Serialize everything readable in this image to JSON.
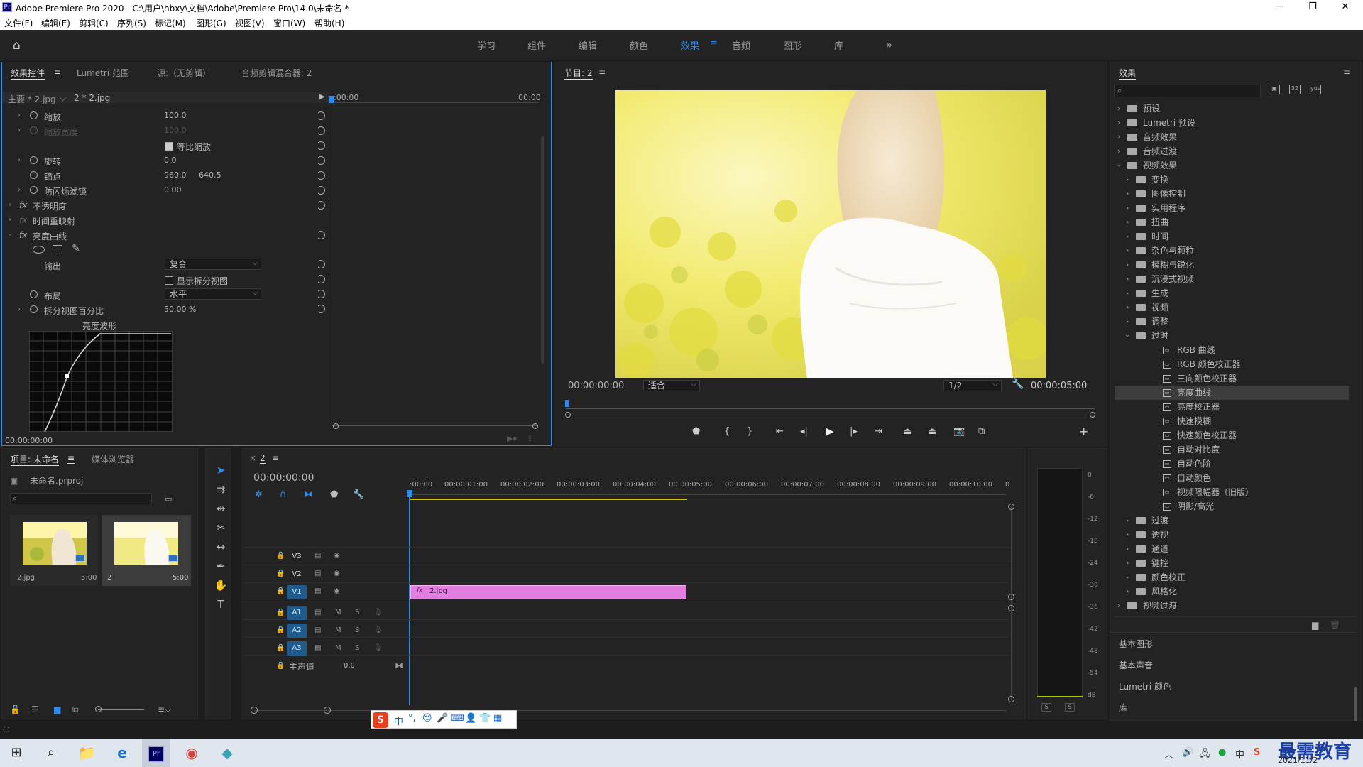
{
  "titlebar": {
    "title": "Adobe Premiere Pro 2020 - C:\\用户\\hbxy\\文档\\Adobe\\Premiere Pro\\14.0\\未命名 *",
    "logo": "Pr"
  },
  "menu": [
    "文件(F)",
    "编辑(E)",
    "剪辑(C)",
    "序列(S)",
    "标记(M)",
    "图形(G)",
    "视图(V)",
    "窗口(W)",
    "帮助(H)"
  ],
  "workspaces": [
    "学习",
    "组件",
    "编辑",
    "颜色",
    "效果",
    "音频",
    "图形",
    "库"
  ],
  "active_workspace": "效果",
  "effect_controls": {
    "tabs": [
      "效果控件",
      "Lumetri 范围",
      "源:（无剪辑）",
      "音频剪辑混合器: 2"
    ],
    "master": "主要 * 2.jpg",
    "clip": "2 * 2.jpg",
    "time_start": ":00:00",
    "time_end": "00:00",
    "rows": [
      {
        "label": "缩放",
        "v1": "100.0"
      },
      {
        "label": "缩放宽度",
        "v1": "100.0"
      },
      {
        "label": "等比缩放",
        "v1": ""
      },
      {
        "label": "旋转",
        "v1": "0.0"
      },
      {
        "label": "锚点",
        "v1": "960.0",
        "v2": "640.5"
      },
      {
        "label": "防闪烁滤镜",
        "v1": "0.00"
      },
      {
        "label": "不透明度"
      },
      {
        "label": "时间重映射"
      },
      {
        "label": "亮度曲线"
      }
    ],
    "output_label": "输出",
    "output_value": "复合",
    "split_view": "显示拆分视图",
    "layout_label": "布局",
    "layout_value": "水平",
    "split_pct_label": "拆分视图百分比",
    "split_pct_value": "50.00 %",
    "waveform_label": "亮度波形",
    "timecode": "00:00:00:00"
  },
  "program": {
    "title": "节目: 2",
    "timecode": "00:00:00:00",
    "fit": "适合",
    "resolution": "1/2",
    "duration": "00:00:05:00"
  },
  "effects": {
    "title": "效果",
    "items": [
      {
        "label": "预设",
        "level": 0,
        "kind": "folder2",
        "open": false
      },
      {
        "label": "Lumetri 预设",
        "level": 0,
        "kind": "folder2",
        "open": false
      },
      {
        "label": "音频效果",
        "level": 0,
        "kind": "folder",
        "open": false
      },
      {
        "label": "音频过渡",
        "level": 0,
        "kind": "folder",
        "open": false
      },
      {
        "label": "视频效果",
        "level": 0,
        "kind": "folder",
        "open": true
      },
      {
        "label": "变换",
        "level": 1,
        "kind": "folder",
        "open": false
      },
      {
        "label": "图像控制",
        "level": 1,
        "kind": "folder",
        "open": false
      },
      {
        "label": "实用程序",
        "level": 1,
        "kind": "folder",
        "open": false
      },
      {
        "label": "扭曲",
        "level": 1,
        "kind": "folder",
        "open": false
      },
      {
        "label": "时间",
        "level": 1,
        "kind": "folder",
        "open": false
      },
      {
        "label": "杂色与颗粒",
        "level": 1,
        "kind": "folder",
        "open": false
      },
      {
        "label": "模糊与锐化",
        "level": 1,
        "kind": "folder",
        "open": false
      },
      {
        "label": "沉浸式视频",
        "level": 1,
        "kind": "folder",
        "open": false
      },
      {
        "label": "生成",
        "level": 1,
        "kind": "folder",
        "open": false
      },
      {
        "label": "视频",
        "level": 1,
        "kind": "folder",
        "open": false
      },
      {
        "label": "调整",
        "level": 1,
        "kind": "folder",
        "open": false
      },
      {
        "label": "过时",
        "level": 1,
        "kind": "folder",
        "open": true
      },
      {
        "label": "RGB 曲线",
        "level": 2,
        "kind": "fx"
      },
      {
        "label": "RGB 颜色校正器",
        "level": 2,
        "kind": "fx"
      },
      {
        "label": "三向颜色校正器",
        "level": 2,
        "kind": "fx"
      },
      {
        "label": "亮度曲线",
        "level": 2,
        "kind": "fx",
        "selected": true
      },
      {
        "label": "亮度校正器",
        "level": 2,
        "kind": "fx"
      },
      {
        "label": "快速模糊",
        "level": 2,
        "kind": "fx"
      },
      {
        "label": "快速颜色校正器",
        "level": 2,
        "kind": "fx"
      },
      {
        "label": "自动对比度",
        "level": 2,
        "kind": "fx"
      },
      {
        "label": "自动色阶",
        "level": 2,
        "kind": "fx"
      },
      {
        "label": "自动颜色",
        "level": 2,
        "kind": "fx"
      },
      {
        "label": "视频限幅器（旧版）",
        "level": 2,
        "kind": "fx"
      },
      {
        "label": "阴影/高光",
        "level": 2,
        "kind": "fx"
      },
      {
        "label": "过渡",
        "level": 1,
        "kind": "folder",
        "open": false
      },
      {
        "label": "透视",
        "level": 1,
        "kind": "folder",
        "open": false
      },
      {
        "label": "通道",
        "level": 1,
        "kind": "folder",
        "open": false
      },
      {
        "label": "键控",
        "level": 1,
        "kind": "folder",
        "open": false
      },
      {
        "label": "颜色校正",
        "level": 1,
        "kind": "folder",
        "open": false
      },
      {
        "label": "风格化",
        "level": 1,
        "kind": "folder",
        "open": false
      },
      {
        "label": "视频过渡",
        "level": 0,
        "kind": "folder",
        "open": false
      }
    ],
    "bottom": [
      "基本图形",
      "基本声音",
      "Lumetri 颜色",
      "库"
    ]
  },
  "project": {
    "tabs": [
      "项目: 未命名",
      "媒体浏览器"
    ],
    "file": "未命名.prproj",
    "items": [
      {
        "name": "2.jpg",
        "duration": "5:00"
      },
      {
        "name": "2",
        "duration": "5:00"
      }
    ]
  },
  "timeline": {
    "tab": "2",
    "timecode": "00:00:00:00",
    "ruler": [
      ":00:00",
      "00:00:01:00",
      "00:00:02:00",
      "00:00:03:00",
      "00:00:04:00",
      "00:00:05:00",
      "00:00:06:00",
      "00:00:07:00",
      "00:00:08:00",
      "00:00:09:00",
      "00:00:10:00",
      "0"
    ],
    "video_tracks": [
      "V3",
      "V2",
      "V1"
    ],
    "audio_tracks": [
      "A1",
      "A2",
      "A3"
    ],
    "master": "主声道",
    "master_value": "0.0",
    "clip": "2.jpg"
  },
  "meter": {
    "scale": [
      "0",
      "-6",
      "-12",
      "-18",
      "-24",
      "-30",
      "-36",
      "-42",
      "-48",
      "-54",
      "dB"
    ],
    "solo": [
      "S",
      "S"
    ]
  },
  "ime": {
    "label": "中"
  },
  "taskbar": {
    "date": "2021/11/2",
    "watermark": "最需教育"
  }
}
